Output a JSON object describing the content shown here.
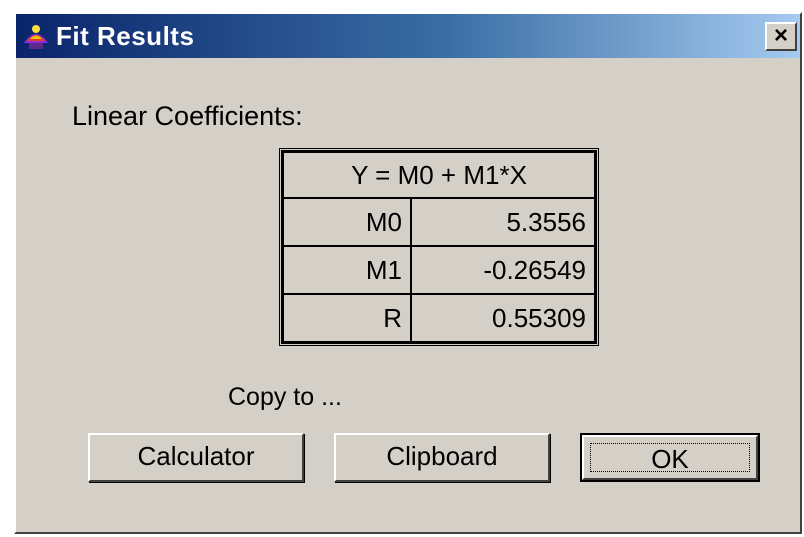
{
  "window": {
    "title": "Fit Results",
    "close_symbol": "×",
    "icon": "app-icon"
  },
  "section_label": "Linear Coefficients:",
  "table": {
    "header": "Y = M0 + M1*X",
    "rows": [
      {
        "name": "M0",
        "value": "5.3556"
      },
      {
        "name": "M1",
        "value": "-0.26549"
      },
      {
        "name": "R",
        "value": "0.55309"
      }
    ]
  },
  "copy_label": "Copy to ...",
  "buttons": {
    "calculator": "Calculator",
    "clipboard": "Clipboard",
    "ok": "OK"
  },
  "colors": {
    "titlebar_start": "#0a246a",
    "titlebar_end": "#a6caf0",
    "face": "#d4d0c8"
  }
}
